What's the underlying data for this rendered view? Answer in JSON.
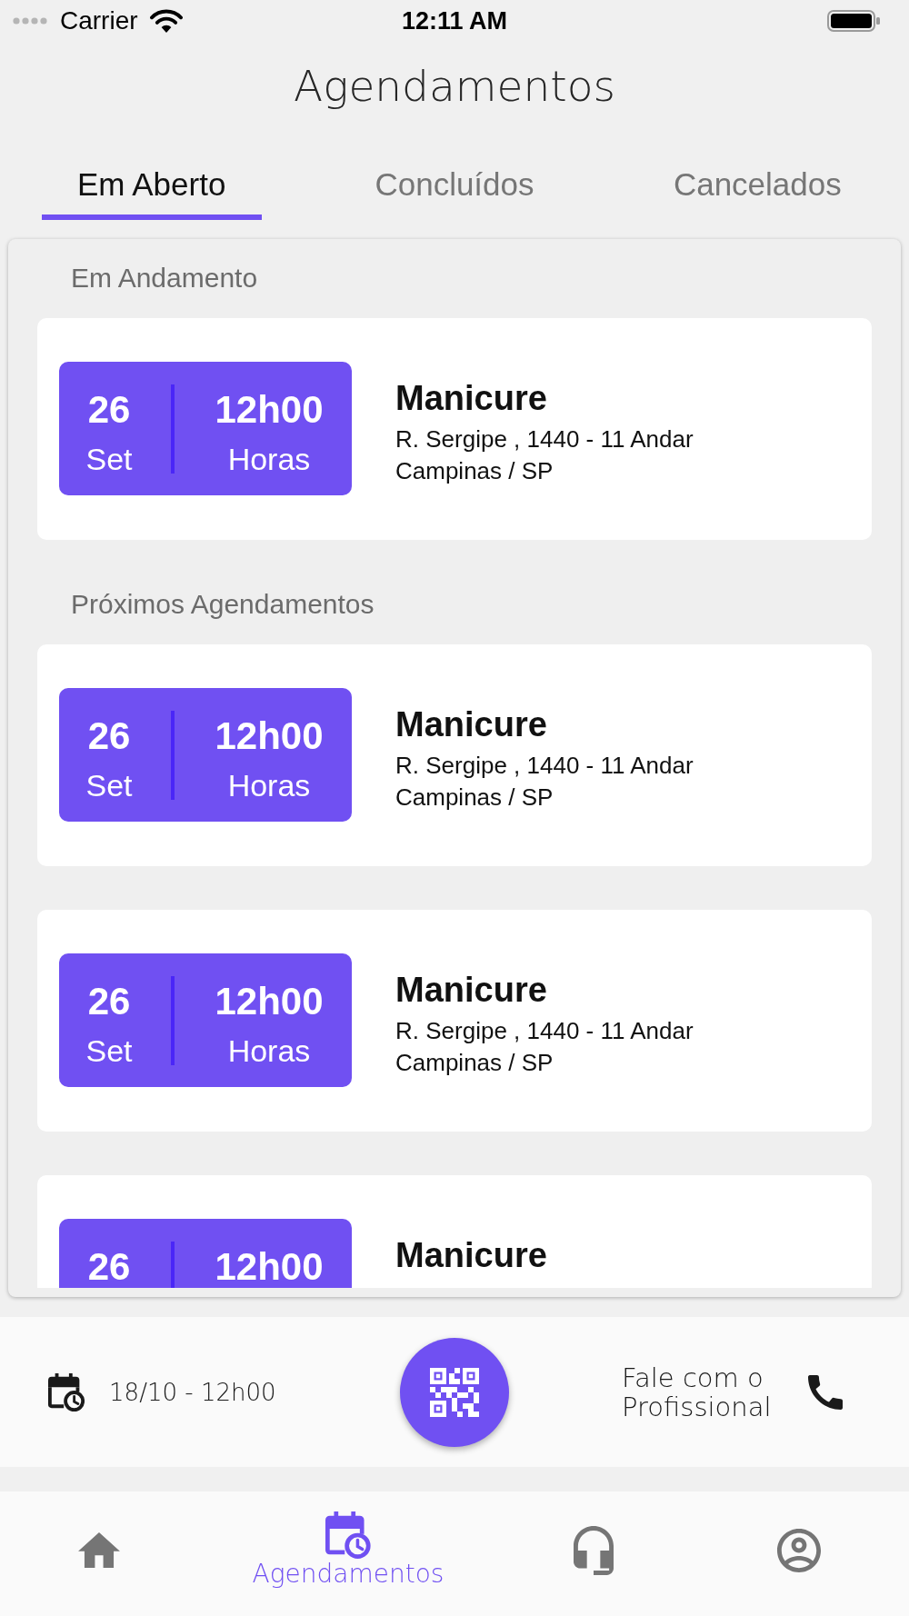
{
  "status_bar": {
    "carrier": "Carrier",
    "time": "12:11 AM"
  },
  "header": {
    "title": "Agendamentos"
  },
  "tabs": [
    {
      "label": "Em Aberto",
      "selected": true
    },
    {
      "label": "Concluídos",
      "selected": false
    },
    {
      "label": "Cancelados",
      "selected": false
    }
  ],
  "sections": [
    {
      "heading": "Em Andamento",
      "appointments": [
        {
          "day": "26",
          "month": "Set",
          "time": "12h00",
          "time_unit": "Horas",
          "service": "Manicure",
          "address": "R. Sergipe , 1440 - 11 Andar",
          "city": "Campinas / SP"
        }
      ]
    },
    {
      "heading": "Próximos Agendamentos",
      "appointments": [
        {
          "day": "26",
          "month": "Set",
          "time": "12h00",
          "time_unit": "Horas",
          "service": "Manicure",
          "address": "R. Sergipe , 1440 - 11 Andar",
          "city": "Campinas / SP"
        },
        {
          "day": "26",
          "month": "Set",
          "time": "12h00",
          "time_unit": "Horas",
          "service": "Manicure",
          "address": "R. Sergipe , 1440 - 11 Andar",
          "city": "Campinas / SP"
        },
        {
          "day": "26",
          "time": "12h00",
          "service": "Manicure"
        }
      ]
    }
  ],
  "action_bar": {
    "next_appointment": "18/10 - 12h00",
    "contact_label": "Fale com o Profissional"
  },
  "bottom_nav": [
    {
      "kind": "home",
      "selected": false
    },
    {
      "kind": "appointments",
      "label": "Agendamentos",
      "selected": true
    },
    {
      "kind": "support",
      "selected": false
    },
    {
      "kind": "profile",
      "selected": false
    }
  ]
}
